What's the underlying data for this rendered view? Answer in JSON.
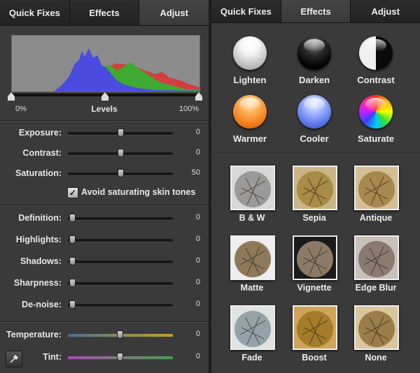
{
  "left_panel": {
    "tabs": [
      {
        "label": "Quick Fixes",
        "active": false
      },
      {
        "label": "Effects",
        "active": false
      },
      {
        "label": "Adjust",
        "active": true
      }
    ],
    "levels": {
      "label": "Levels",
      "min_label": "0%",
      "max_label": "100%"
    },
    "sliders_group1": [
      {
        "label": "Exposure:",
        "value": "0",
        "level": 0.5
      },
      {
        "label": "Contrast:",
        "value": "0",
        "level": 0.5
      },
      {
        "label": "Saturation:",
        "value": "50",
        "level": 0.5
      }
    ],
    "skin_tones_checkbox": {
      "label": "Avoid saturating skin tones",
      "checked": true
    },
    "sliders_group2": [
      {
        "label": "Definition:",
        "value": "0",
        "level": 0
      },
      {
        "label": "Highlights:",
        "value": "0",
        "level": 0
      },
      {
        "label": "Shadows:",
        "value": "0",
        "level": 0
      },
      {
        "label": "Sharpness:",
        "value": "0",
        "level": 0
      },
      {
        "label": "De-noise:",
        "value": "0",
        "level": 0
      }
    ],
    "temperature": {
      "label": "Temperature:",
      "value": "0",
      "level": 0.5
    },
    "tint": {
      "label": "Tint:",
      "value": "0",
      "level": 0.5
    },
    "eyedropper_icon": "eyedropper-icon"
  },
  "right_panel": {
    "tabs": [
      {
        "label": "Quick Fixes",
        "active": false
      },
      {
        "label": "Effects",
        "active": true
      },
      {
        "label": "Adjust",
        "active": false
      }
    ],
    "quick_effects": [
      {
        "label": "Lighten",
        "style": "light"
      },
      {
        "label": "Darken",
        "style": "dark"
      },
      {
        "label": "Contrast",
        "style": "contrast"
      },
      {
        "label": "Warmer",
        "style": "warm"
      },
      {
        "label": "Cooler",
        "style": "cool"
      },
      {
        "label": "Saturate",
        "style": "sat"
      }
    ],
    "effect_presets": [
      {
        "label": "B & W",
        "tone": "#9a9a9a",
        "bg": "#d8d8d8"
      },
      {
        "label": "Sepia",
        "tone": "#a88b46",
        "bg": "#c9b585"
      },
      {
        "label": "Antique",
        "tone": "#a7884e",
        "bg": "#d4bf95"
      },
      {
        "label": "Matte",
        "tone": "#8e7a5a",
        "bg": "#eeeeee"
      },
      {
        "label": "Vignette",
        "tone": "#8a7a66",
        "bg": "#1a1a1a"
      },
      {
        "label": "Edge Blur",
        "tone": "#8a7a70",
        "bg": "#c9c0b8"
      },
      {
        "label": "Fade",
        "tone": "#93a3a8",
        "bg": "#dfe3e2"
      },
      {
        "label": "Boost",
        "tone": "#a57d2a",
        "bg": "#cfa45a"
      },
      {
        "label": "None",
        "tone": "#9a7d48",
        "bg": "#d9c69d"
      }
    ]
  }
}
